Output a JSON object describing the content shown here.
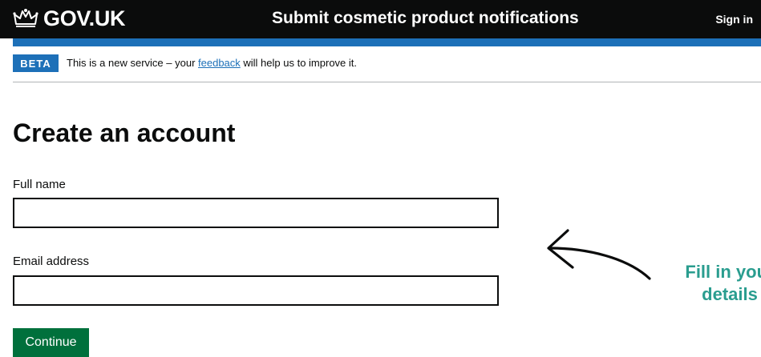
{
  "header": {
    "logo_text": "GOV.UK",
    "service_name": "Submit cosmetic product notifications",
    "sign_in_label": "Sign in"
  },
  "phase_banner": {
    "tag": "BETA",
    "text_before": "This is a new service – your ",
    "link_text": "feedback",
    "text_after": " will help us to improve it."
  },
  "main": {
    "title": "Create an account",
    "full_name": {
      "label": "Full name",
      "value": ""
    },
    "email": {
      "label": "Email address",
      "value": ""
    },
    "continue_label": "Continue"
  },
  "annotation": {
    "line1": "Fill in your",
    "line2": "details"
  },
  "icons": [
    "crown-icon",
    "arrow-icon"
  ],
  "colors": {
    "header_bg": "#0b0c0c",
    "brand_blue": "#1d70b8",
    "button_green": "#00703c",
    "annotation_teal": "#2a9d8f"
  }
}
